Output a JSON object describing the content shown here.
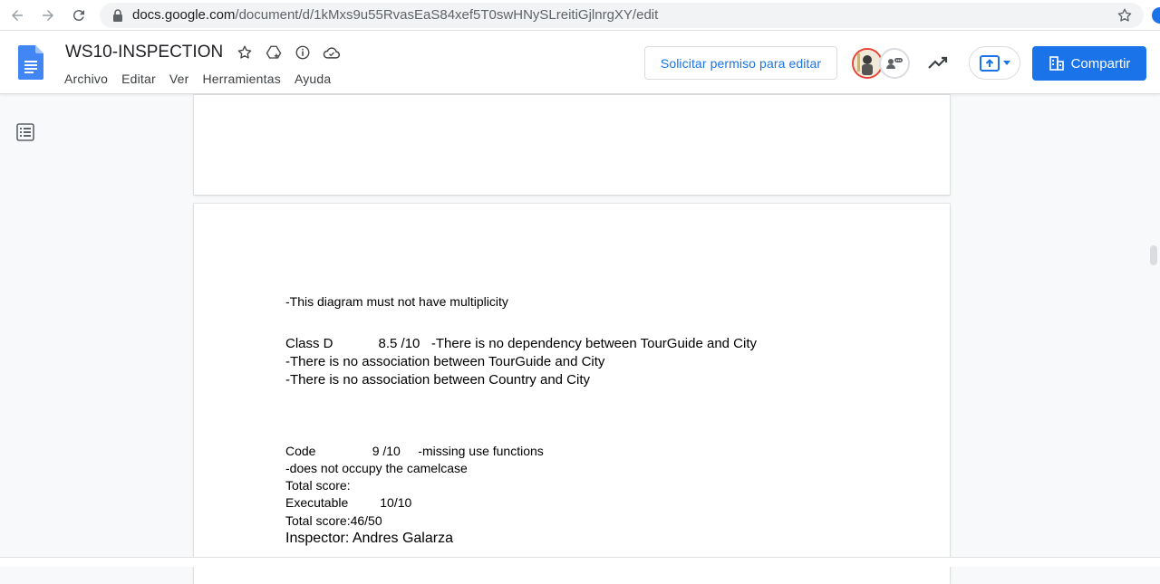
{
  "browser": {
    "url_host": "docs.google.com",
    "url_path": "/document/d/1kMxs9u55RvasEaS84xef5T0swHNySLreitiGjlnrgXY/edit"
  },
  "docs": {
    "title": "WS10-INSPECTION",
    "menu": [
      "Archivo",
      "Editar",
      "Ver",
      "Herramientas",
      "Ayuda"
    ],
    "request_edit_label": "Solicitar permiso para editar",
    "share_label": "Compartir",
    "colors": {
      "accent": "#1a73e8",
      "avatar_ring": "#ea4335"
    }
  },
  "document": {
    "lines": {
      "l1": "-This diagram must not have multiplicity",
      "l2": "Class D            8.5 /10   -There is no dependency between TourGuide and City",
      "l3": "-There is no association between TourGuide and City",
      "l4": "-There is no association between Country and City",
      "l5": "Code                9 /10     -missing use functions",
      "l6": "-does not occupy the camelcase",
      "l7": "Total score:",
      "l8": "Executable         10/10",
      "l9": "Total score:46/50",
      "l10": "Inspector: Andres Galarza"
    }
  }
}
